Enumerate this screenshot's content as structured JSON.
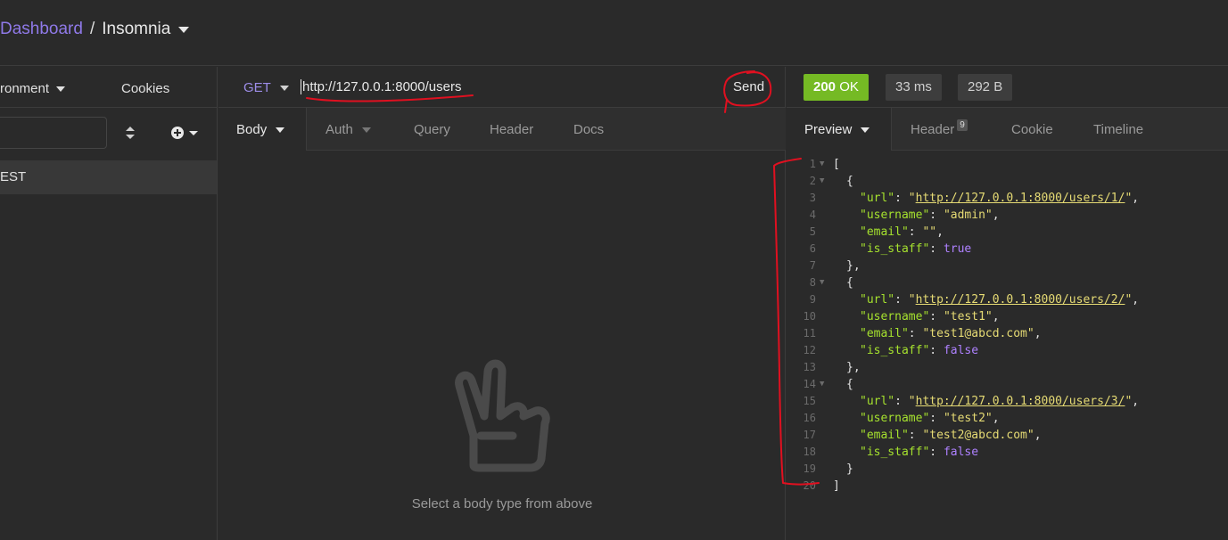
{
  "titlebar": {
    "dashboard": "Dashboard",
    "separator": "/",
    "project": "Insomnia"
  },
  "sidebar": {
    "environment": "ronment",
    "cookies": "Cookies",
    "request_item": "EST"
  },
  "request": {
    "method": "GET",
    "url": "http://127.0.0.1:8000/users",
    "send": "Send",
    "tabs": {
      "body": "Body",
      "auth": "Auth",
      "query": "Query",
      "header": "Header",
      "docs": "Docs"
    },
    "empty_message": "Select a body type from above"
  },
  "response": {
    "status_code": "200",
    "status_text": "OK",
    "time": "33 ms",
    "size": "292 B",
    "tabs": {
      "preview": "Preview",
      "header": "Header",
      "header_count": "9",
      "cookie": "Cookie",
      "timeline": "Timeline"
    },
    "lines": [
      {
        "n": "1",
        "fold": true,
        "indent": 0,
        "text": "["
      },
      {
        "n": "2",
        "fold": true,
        "indent": 1,
        "text": "{"
      },
      {
        "n": "3",
        "indent": 2,
        "key": "url",
        "value": "http://127.0.0.1:8000/users/1/",
        "type": "url"
      },
      {
        "n": "4",
        "indent": 2,
        "key": "username",
        "value": "admin",
        "type": "str"
      },
      {
        "n": "5",
        "indent": 2,
        "key": "email",
        "value": "",
        "type": "str"
      },
      {
        "n": "6",
        "indent": 2,
        "key": "is_staff",
        "value": "true",
        "type": "bool",
        "last": true
      },
      {
        "n": "7",
        "indent": 1,
        "text": "},"
      },
      {
        "n": "8",
        "fold": true,
        "indent": 1,
        "text": "{"
      },
      {
        "n": "9",
        "indent": 2,
        "key": "url",
        "value": "http://127.0.0.1:8000/users/2/",
        "type": "url"
      },
      {
        "n": "10",
        "indent": 2,
        "key": "username",
        "value": "test1",
        "type": "str"
      },
      {
        "n": "11",
        "indent": 2,
        "key": "email",
        "value": "test1@abcd.com",
        "type": "str"
      },
      {
        "n": "12",
        "indent": 2,
        "key": "is_staff",
        "value": "false",
        "type": "bool",
        "last": true
      },
      {
        "n": "13",
        "indent": 1,
        "text": "},"
      },
      {
        "n": "14",
        "fold": true,
        "indent": 1,
        "text": "{"
      },
      {
        "n": "15",
        "indent": 2,
        "key": "url",
        "value": "http://127.0.0.1:8000/users/3/",
        "type": "url"
      },
      {
        "n": "16",
        "indent": 2,
        "key": "username",
        "value": "test2",
        "type": "str"
      },
      {
        "n": "17",
        "indent": 2,
        "key": "email",
        "value": "test2@abcd.com",
        "type": "str"
      },
      {
        "n": "18",
        "indent": 2,
        "key": "is_staff",
        "value": "false",
        "type": "bool",
        "last": true
      },
      {
        "n": "19",
        "indent": 1,
        "text": "}"
      },
      {
        "n": "20",
        "indent": 0,
        "text": "]"
      }
    ]
  },
  "icons": {
    "sort": "sort-icon",
    "add": "plus-circle-icon",
    "empty_state": "peace-hand-icon"
  },
  "colors": {
    "accent": "#8f79e8",
    "status_ok": "#75ba24",
    "annotation": "#e01020"
  }
}
